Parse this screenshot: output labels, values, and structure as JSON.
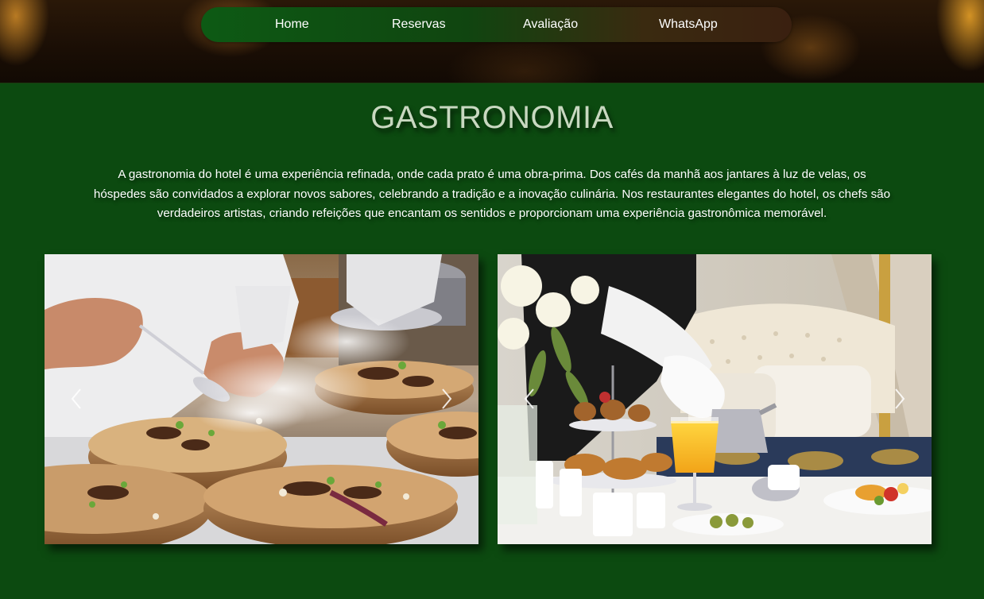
{
  "nav": {
    "items": [
      {
        "label": "Home"
      },
      {
        "label": "Reservas"
      },
      {
        "label": "Avaliação"
      },
      {
        "label": "WhatsApp"
      }
    ]
  },
  "section": {
    "title": "GASTRONOMIA",
    "intro": "A gastronomia do hotel é uma experiência refinada, onde cada prato é uma obra-prima. Dos cafés da manhã aos jantares à luz de velas, os hóspedes são convidados a explorar novos sabores, celebrando a tradição e a inovação culinária. Nos restaurantes elegantes do hotel, os chefs são verdadeiros artistas, criando refeições que encantam os sentidos e proporcionam uma experiência gastronômica memorável."
  },
  "carousels": [
    {
      "photo": "chef-plating-wooden-boards-photo",
      "prev_icon": "chevron-left-icon",
      "next_icon": "chevron-right-icon"
    },
    {
      "photo": "room-service-breakfast-photo",
      "prev_icon": "chevron-left-icon",
      "next_icon": "chevron-right-icon"
    }
  ],
  "colors": {
    "page_background": "#0c4a10",
    "nav_start": "#0d5a14",
    "nav_end": "#3a2010",
    "title": "#c8d8c0",
    "text": "#ffffff"
  }
}
